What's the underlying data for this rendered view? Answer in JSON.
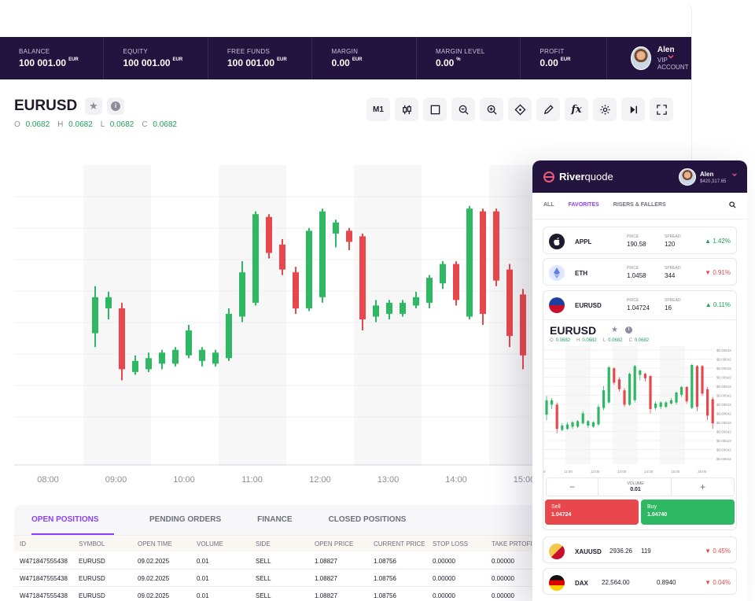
{
  "account": {
    "items": [
      {
        "label": "BALANCE",
        "value": "100 001.00",
        "cur": "EUR"
      },
      {
        "label": "EQUITY",
        "value": "100 001.00",
        "cur": "EUR"
      },
      {
        "label": "FREE FUNDS",
        "value": "100 001.00",
        "cur": "EUR"
      },
      {
        "label": "MARGIN",
        "value": "0.00",
        "cur": "EUR"
      },
      {
        "label": "MARGIN LEVEL",
        "value": "0.00",
        "cur": "%"
      },
      {
        "label": "PROFIT",
        "value": "0.00",
        "cur": "EUR"
      }
    ],
    "user_name": "Alen",
    "user_sub": "VIP ACCOUNT"
  },
  "symbol": {
    "name": "EURUSD",
    "ohlc": [
      {
        "k": "O",
        "v": "0.0682"
      },
      {
        "k": "H",
        "v": "0.0682"
      },
      {
        "k": "L",
        "v": "0.0682"
      },
      {
        "k": "C",
        "v": "0.0682"
      }
    ]
  },
  "toolbar": {
    "timeframe": "M1"
  },
  "icons": [
    "star-icon",
    "info-icon",
    "candles-icon",
    "square-icon",
    "zoom-out-icon",
    "zoom-in-icon",
    "move-icon",
    "pencil-icon",
    "function-icon",
    "gear-icon",
    "skip-icon",
    "fullscreen-icon",
    "chevron-down-icon",
    "search-icon"
  ],
  "chart_data": {
    "type": "candlestick",
    "x": [
      "08:00",
      "09:00",
      "10:00",
      "11:00",
      "12:00",
      "13:00",
      "14:00",
      "15:00"
    ],
    "candles": [
      {
        "o": 45,
        "c": 58,
        "h": 62,
        "l": 40
      },
      {
        "o": 54,
        "c": 58,
        "h": 60,
        "l": 50
      },
      {
        "o": 54,
        "c": 32,
        "h": 56,
        "l": 28
      },
      {
        "o": 31,
        "c": 35,
        "h": 37,
        "l": 30
      },
      {
        "o": 32,
        "c": 36,
        "h": 38,
        "l": 31
      },
      {
        "o": 34,
        "c": 38,
        "h": 39,
        "l": 32
      },
      {
        "o": 34,
        "c": 39,
        "h": 40,
        "l": 33
      },
      {
        "o": 37,
        "c": 46,
        "h": 48,
        "l": 36
      },
      {
        "o": 35,
        "c": 39,
        "h": 40,
        "l": 33
      },
      {
        "o": 34,
        "c": 38,
        "h": 39,
        "l": 33
      },
      {
        "o": 36,
        "c": 52,
        "h": 54,
        "l": 35
      },
      {
        "o": 51,
        "c": 67,
        "h": 71,
        "l": 49
      },
      {
        "o": 56,
        "c": 88,
        "h": 89,
        "l": 55
      },
      {
        "o": 87,
        "c": 74,
        "h": 88,
        "l": 72
      },
      {
        "o": 77,
        "c": 68,
        "h": 79,
        "l": 66
      },
      {
        "o": 67,
        "c": 54,
        "h": 69,
        "l": 52
      },
      {
        "o": 54,
        "c": 82,
        "h": 83,
        "l": 53
      },
      {
        "o": 58,
        "c": 89,
        "h": 90,
        "l": 56
      },
      {
        "o": 81,
        "c": 85,
        "h": 86,
        "l": 76
      },
      {
        "o": 82,
        "c": 78,
        "h": 83,
        "l": 75
      },
      {
        "o": 80,
        "c": 50,
        "h": 81,
        "l": 46
      },
      {
        "o": 51,
        "c": 55,
        "h": 57,
        "l": 49
      },
      {
        "o": 52,
        "c": 56,
        "h": 57,
        "l": 50
      },
      {
        "o": 52,
        "c": 56,
        "h": 57,
        "l": 51
      },
      {
        "o": 55,
        "c": 58,
        "h": 60,
        "l": 54
      },
      {
        "o": 56,
        "c": 65,
        "h": 66,
        "l": 54
      },
      {
        "o": 63,
        "c": 70,
        "h": 71,
        "l": 61
      },
      {
        "o": 70,
        "c": 57,
        "h": 71,
        "l": 55
      },
      {
        "o": 51,
        "c": 90,
        "h": 91,
        "l": 50
      },
      {
        "o": 89,
        "c": 52,
        "h": 90,
        "l": 48
      },
      {
        "o": 89,
        "c": 64,
        "h": 90,
        "l": 62
      },
      {
        "o": 68,
        "c": 44,
        "h": 70,
        "l": 40
      },
      {
        "o": 59,
        "c": 37,
        "h": 61,
        "l": 32
      }
    ]
  },
  "tabs": [
    "OPEN POSITIONS",
    "PENDING ORDERS",
    "FINANCE",
    "CLOSED POSITIONS"
  ],
  "table": {
    "headers": [
      "ID",
      "SYMBOL",
      "OPEN TIME",
      "VOLUME",
      "SIDE",
      "OPEN PRICE",
      "CURRENT PRICE",
      "STOP LOSS",
      "TAKE PRTOFIT"
    ],
    "rows": [
      [
        "W471847555438",
        "EURUSD",
        "09.02.2025",
        "0.01",
        "SELL",
        "1.08827",
        "1.08756",
        "0.00000",
        "0.00000"
      ],
      [
        "W471847555438",
        "EURUSD",
        "09.02.2025",
        "0.01",
        "SELL",
        "1.08827",
        "1.08756",
        "0.00000",
        "0.00000"
      ],
      [
        "W471847555438",
        "EURUSD",
        "09.02.2025",
        "0.01",
        "SELL",
        "1.08827",
        "1.08756",
        "0.00000",
        "0.00000"
      ]
    ]
  },
  "mobile": {
    "brand_bold": "River",
    "brand_rest": "quode",
    "user_name": "Alen",
    "user_balance": "$420,317.65",
    "tabs": [
      "ALL",
      "FAVORITES",
      "RISERS & FALLERS"
    ],
    "assets": [
      {
        "sym": "APPL",
        "price_label": "PRICE",
        "price": "190.58",
        "spread_label": "SPREAD",
        "spread": "120",
        "chg": "1.42%",
        "dir": "up"
      },
      {
        "sym": "ETH",
        "price_label": "PRICE",
        "price": "1.0458",
        "spread_label": "SPREAD",
        "spread": "344",
        "chg": "0.91%",
        "dir": "down"
      },
      {
        "sym": "EURUSD",
        "price_label": "PRICE",
        "price": "1.04724",
        "spread_label": "SPREAD",
        "spread": "16",
        "chg": "0.11%",
        "dir": "up"
      }
    ],
    "detail": {
      "name": "EURUSD",
      "ohlc": [
        {
          "k": "O",
          "v": "0.0682"
        },
        {
          "k": "H",
          "v": "0.0682"
        },
        {
          "k": "L",
          "v": "0.0682"
        },
        {
          "k": "C",
          "v": "0.0682"
        }
      ],
      "y_ticks": [
        "$0.00642",
        "$0.00642",
        "$0.00642",
        "$0.00642",
        "$0.00642",
        "$0.00642",
        "$0.00642",
        "$0.00642",
        "$0.00642",
        "$0.00642",
        "$0.00642",
        "$0.00642",
        "$0.00642"
      ],
      "x_ticks": [
        "11:00",
        "12:00",
        "13:00",
        "14:00",
        "15:00",
        "16:00"
      ],
      "x_first": "0",
      "volume_label": "VOLUME",
      "volume": "0.01",
      "minus": "−",
      "plus": "+",
      "sell_label": "Sell",
      "sell_price": "1.04724",
      "buy_label": "Buy",
      "buy_price": "1.04740"
    },
    "bottom_assets": [
      {
        "sym": "XAUUSD",
        "price": "2936.26",
        "spread": "119",
        "chg": "0.45%",
        "dir": "down"
      },
      {
        "sym": "DAX",
        "price": "22,564.00",
        "spread": "0.8940",
        "chg": "0.04%",
        "dir": "down"
      }
    ]
  },
  "colors": {
    "header_bg": "#22133f",
    "accent": "#8a3ffc",
    "brand": "#e8597a",
    "up": "#2fb863",
    "down": "#e8484c"
  }
}
